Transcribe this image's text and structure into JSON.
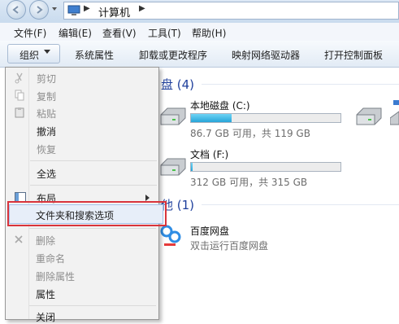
{
  "address": {
    "crumb": "计算机"
  },
  "menubar": [
    {
      "label": "文件(F)"
    },
    {
      "label": "编辑(E)"
    },
    {
      "label": "查看(V)"
    },
    {
      "label": "工具(T)"
    },
    {
      "label": "帮助(H)"
    }
  ],
  "toolbar": {
    "organize": "组织",
    "items": [
      {
        "label": "系统属性"
      },
      {
        "label": "卸载或更改程序"
      },
      {
        "label": "映射网络驱动器"
      },
      {
        "label": "打开控制面板"
      }
    ]
  },
  "groups": {
    "drives_header": "盘 (4)",
    "other_header": "他 (1)"
  },
  "drives": [
    {
      "name": "本地磁盘 (C:)",
      "free": "86.7 GB 可用，共 119 GB",
      "used_fraction": 0.27
    },
    {
      "name": "文档 (F:)",
      "free": "312 GB 可用，共 315 GB",
      "used_fraction": 0.01
    }
  ],
  "other": {
    "name": "百度网盘",
    "desc": "双击运行百度网盘"
  },
  "context_menu": {
    "cut": "剪切",
    "copy": "复制",
    "paste": "粘贴",
    "undo": "撤消",
    "redo": "恢复",
    "select_all": "全选",
    "layout": "布局",
    "folder_options": "文件夹和搜索选项",
    "delete": "删除",
    "rename": "重命名",
    "remove_props": "删除属性",
    "properties": "属性",
    "close": "关闭"
  },
  "colors": {
    "highlight_border": "#d9343c",
    "link_blue": "#1e3f9c",
    "drive_fill": "#26a5d9"
  }
}
